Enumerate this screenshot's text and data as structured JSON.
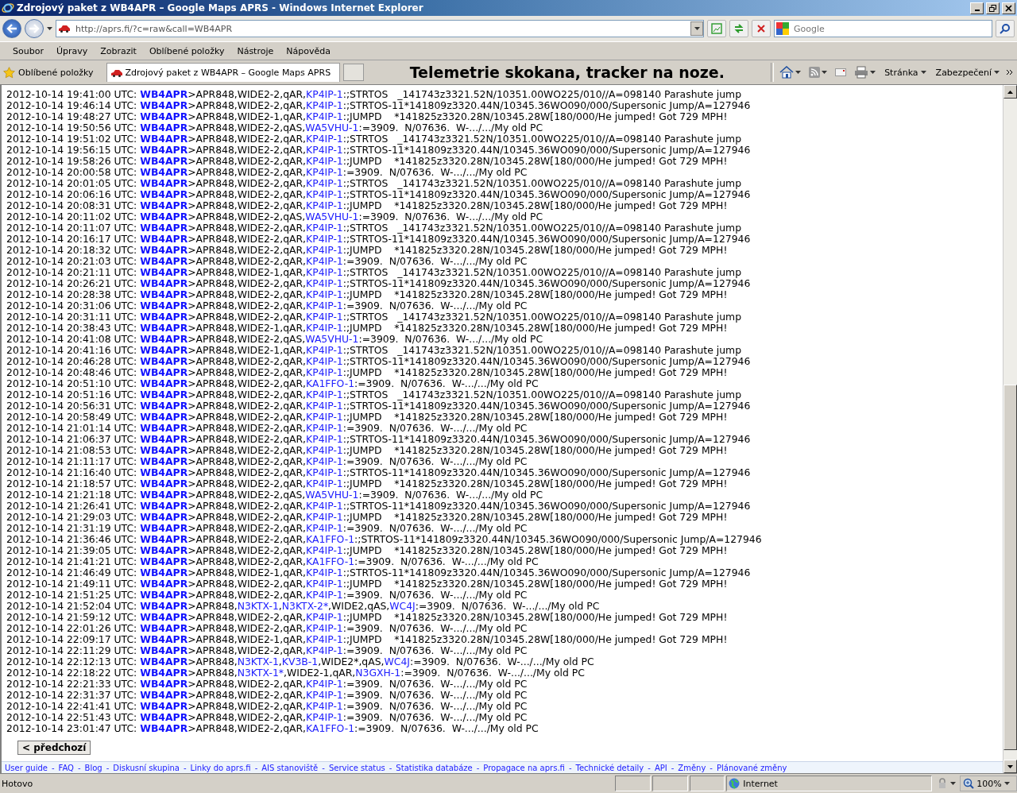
{
  "window": {
    "title": "Zdrojový paket z WB4APR – Google Maps APRS - Windows Internet Explorer"
  },
  "address_bar": {
    "value": "http://aprs.fi/?c=raw&call=WB4APR"
  },
  "search": {
    "placeholder": "Google"
  },
  "menu": [
    "Soubor",
    "Úpravy",
    "Zobrazit",
    "Oblíbené položky",
    "Nástroje",
    "Nápověda"
  ],
  "favorites": {
    "label": "Oblíbené položky"
  },
  "tabs": [
    {
      "label": "Zdrojový paket z WB4APR – Google Maps APRS",
      "selected": true
    }
  ],
  "page_heading": "Telemetrie skokana, tracker na noze.",
  "command_bar": [
    "Stránka",
    "Zabezpečení"
  ],
  "log": [
    {
      "time": "2012-10-14 19:41:00 UTC:",
      "source": "WB4APR",
      "parts": [
        {
          "text": ">APR848,WIDE2-2,qAR,",
          "link": false
        },
        {
          "text": "KP4IP-1",
          "link": true
        },
        {
          "text": ":;STRTOS   _141743z3321.52N/10351.00WO225/010//A=098140 Parashute jump",
          "link": false
        }
      ]
    },
    {
      "time": "2012-10-14 19:46:14 UTC:",
      "source": "WB4APR",
      "parts": [
        {
          "text": ">APR848,WIDE2-2,qAR,",
          "link": false
        },
        {
          "text": "KP4IP-1",
          "link": true
        },
        {
          "text": ":;STRTOS-11*141809z3320.44N/10345.36WO090/000/Supersonic Jump/A=127946",
          "link": false
        }
      ]
    },
    {
      "time": "2012-10-14 19:48:27 UTC:",
      "source": "WB4APR",
      "parts": [
        {
          "text": ">APR848,WIDE2-1,qAR,",
          "link": false
        },
        {
          "text": "KP4IP-1",
          "link": true
        },
        {
          "text": ":;JUMPD    *141825z3320.28N/10345.28W[180/000/He jumped! Got 729 MPH!",
          "link": false
        }
      ]
    },
    {
      "time": "2012-10-14 19:50:56 UTC:",
      "source": "WB4APR",
      "parts": [
        {
          "text": ">APR848,WIDE2-2,qAS,",
          "link": false
        },
        {
          "text": "WA5VHU-1",
          "link": true
        },
        {
          "text": ":=3909.  N/07636.  W-.../.../My old PC",
          "link": false
        }
      ]
    },
    {
      "time": "2012-10-14 19:51:02 UTC:",
      "source": "WB4APR",
      "parts": [
        {
          "text": ">APR848,WIDE2-2,qAR,",
          "link": false
        },
        {
          "text": "KP4IP-1",
          "link": true
        },
        {
          "text": ":;STRTOS   _141743z3321.52N/10351.00WO225/010//A=098140 Parashute jump",
          "link": false
        }
      ]
    },
    {
      "time": "2012-10-14 19:56:15 UTC:",
      "source": "WB4APR",
      "parts": [
        {
          "text": ">APR848,WIDE2-2,qAR,",
          "link": false
        },
        {
          "text": "KP4IP-1",
          "link": true
        },
        {
          "text": ":;STRTOS-11*141809z3320.44N/10345.36WO090/000/Supersonic Jump/A=127946",
          "link": false
        }
      ]
    },
    {
      "time": "2012-10-14 19:58:26 UTC:",
      "source": "WB4APR",
      "parts": [
        {
          "text": ">APR848,WIDE2-2,qAR,",
          "link": false
        },
        {
          "text": "KP4IP-1",
          "link": true
        },
        {
          "text": ":;JUMPD    *141825z3320.28N/10345.28W[180/000/He jumped! Got 729 MPH!",
          "link": false
        }
      ]
    },
    {
      "time": "2012-10-14 20:00:58 UTC:",
      "source": "WB4APR",
      "parts": [
        {
          "text": ">APR848,WIDE2-2,qAR,",
          "link": false
        },
        {
          "text": "KP4IP-1",
          "link": true
        },
        {
          "text": ":=3909.  N/07636.  W-.../.../My old PC",
          "link": false
        }
      ]
    },
    {
      "time": "2012-10-14 20:01:05 UTC:",
      "source": "WB4APR",
      "parts": [
        {
          "text": ">APR848,WIDE2-2,qAR,",
          "link": false
        },
        {
          "text": "KP4IP-1",
          "link": true
        },
        {
          "text": ":;STRTOS   _141743z3321.52N/10351.00WO225/010//A=098140 Parashute jump",
          "link": false
        }
      ]
    },
    {
      "time": "2012-10-14 20:06:16 UTC:",
      "source": "WB4APR",
      "parts": [
        {
          "text": ">APR848,WIDE2-2,qAR,",
          "link": false
        },
        {
          "text": "KP4IP-1",
          "link": true
        },
        {
          "text": ":;STRTOS-11*141809z3320.44N/10345.36WO090/000/Supersonic Jump/A=127946",
          "link": false
        }
      ]
    },
    {
      "time": "2012-10-14 20:08:31 UTC:",
      "source": "WB4APR",
      "parts": [
        {
          "text": ">APR848,WIDE2-2,qAR,",
          "link": false
        },
        {
          "text": "KP4IP-1",
          "link": true
        },
        {
          "text": ":;JUMPD    *141825z3320.28N/10345.28W[180/000/He jumped! Got 729 MPH!",
          "link": false
        }
      ]
    },
    {
      "time": "2012-10-14 20:11:02 UTC:",
      "source": "WB4APR",
      "parts": [
        {
          "text": ">APR848,WIDE2-2,qAS,",
          "link": false
        },
        {
          "text": "WA5VHU-1",
          "link": true
        },
        {
          "text": ":=3909.  N/07636.  W-.../.../My old PC",
          "link": false
        }
      ]
    },
    {
      "time": "2012-10-14 20:11:07 UTC:",
      "source": "WB4APR",
      "parts": [
        {
          "text": ">APR848,WIDE2-2,qAR,",
          "link": false
        },
        {
          "text": "KP4IP-1",
          "link": true
        },
        {
          "text": ":;STRTOS   _141743z3321.52N/10351.00WO225/010//A=098140 Parashute jump",
          "link": false
        }
      ]
    },
    {
      "time": "2012-10-14 20:16:17 UTC:",
      "source": "WB4APR",
      "parts": [
        {
          "text": ">APR848,WIDE2-2,qAR,",
          "link": false
        },
        {
          "text": "KP4IP-1",
          "link": true
        },
        {
          "text": ":;STRTOS-11*141809z3320.44N/10345.36WO090/000/Supersonic Jump/A=127946",
          "link": false
        }
      ]
    },
    {
      "time": "2012-10-14 20:18:32 UTC:",
      "source": "WB4APR",
      "parts": [
        {
          "text": ">APR848,WIDE2-2,qAR,",
          "link": false
        },
        {
          "text": "KP4IP-1",
          "link": true
        },
        {
          "text": ":;JUMPD    *141825z3320.28N/10345.28W[180/000/He jumped! Got 729 MPH!",
          "link": false
        }
      ]
    },
    {
      "time": "2012-10-14 20:21:03 UTC:",
      "source": "WB4APR",
      "parts": [
        {
          "text": ">APR848,WIDE2-2,qAR,",
          "link": false
        },
        {
          "text": "KP4IP-1",
          "link": true
        },
        {
          "text": ":=3909.  N/07636.  W-.../.../My old PC",
          "link": false
        }
      ]
    },
    {
      "time": "2012-10-14 20:21:11 UTC:",
      "source": "WB4APR",
      "parts": [
        {
          "text": ">APR848,WIDE2-1,qAR,",
          "link": false
        },
        {
          "text": "KP4IP-1",
          "link": true
        },
        {
          "text": ":;STRTOS   _141743z3321.52N/10351.00WO225/010//A=098140 Parashute jump",
          "link": false
        }
      ]
    },
    {
      "time": "2012-10-14 20:26:21 UTC:",
      "source": "WB4APR",
      "parts": [
        {
          "text": ">APR848,WIDE2-2,qAR,",
          "link": false
        },
        {
          "text": "KP4IP-1",
          "link": true
        },
        {
          "text": ":;STRTOS-11*141809z3320.44N/10345.36WO090/000/Supersonic Jump/A=127946",
          "link": false
        }
      ]
    },
    {
      "time": "2012-10-14 20:28:38 UTC:",
      "source": "WB4APR",
      "parts": [
        {
          "text": ">APR848,WIDE2-2,qAR,",
          "link": false
        },
        {
          "text": "KP4IP-1",
          "link": true
        },
        {
          "text": ":;JUMPD    *141825z3320.28N/10345.28W[180/000/He jumped! Got 729 MPH!",
          "link": false
        }
      ]
    },
    {
      "time": "2012-10-14 20:31:06 UTC:",
      "source": "WB4APR",
      "parts": [
        {
          "text": ">APR848,WIDE2-2,qAR,",
          "link": false
        },
        {
          "text": "KP4IP-1",
          "link": true
        },
        {
          "text": ":=3909.  N/07636.  W-.../.../My old PC",
          "link": false
        }
      ]
    },
    {
      "time": "2012-10-14 20:31:11 UTC:",
      "source": "WB4APR",
      "parts": [
        {
          "text": ">APR848,WIDE2-2,qAR,",
          "link": false
        },
        {
          "text": "KP4IP-1",
          "link": true
        },
        {
          "text": ":;STRTOS   _141743z3321.52N/10351.00WO225/010//A=098140 Parashute jump",
          "link": false
        }
      ]
    },
    {
      "time": "2012-10-14 20:38:43 UTC:",
      "source": "WB4APR",
      "parts": [
        {
          "text": ">APR848,WIDE2-1,qAR,",
          "link": false
        },
        {
          "text": "KP4IP-1",
          "link": true
        },
        {
          "text": ":;JUMPD    *141825z3320.28N/10345.28W[180/000/He jumped! Got 729 MPH!",
          "link": false
        }
      ]
    },
    {
      "time": "2012-10-14 20:41:08 UTC:",
      "source": "WB4APR",
      "parts": [
        {
          "text": ">APR848,WIDE2-2,qAS,",
          "link": false
        },
        {
          "text": "WA5VHU-1",
          "link": true
        },
        {
          "text": ":=3909.  N/07636.  W-.../.../My old PC",
          "link": false
        }
      ]
    },
    {
      "time": "2012-10-14 20:41:16 UTC:",
      "source": "WB4APR",
      "parts": [
        {
          "text": ">APR848,WIDE2-1,qAR,",
          "link": false
        },
        {
          "text": "KP4IP-1",
          "link": true
        },
        {
          "text": ":;STRTOS   _141743z3321.52N/10351.00WO225/010//A=098140 Parashute jump",
          "link": false
        }
      ]
    },
    {
      "time": "2012-10-14 20:46:28 UTC:",
      "source": "WB4APR",
      "parts": [
        {
          "text": ">APR848,WIDE2-2,qAR,",
          "link": false
        },
        {
          "text": "KP4IP-1",
          "link": true
        },
        {
          "text": ":;STRTOS-11*141809z3320.44N/10345.36WO090/000/Supersonic Jump/A=127946",
          "link": false
        }
      ]
    },
    {
      "time": "2012-10-14 20:48:46 UTC:",
      "source": "WB4APR",
      "parts": [
        {
          "text": ">APR848,WIDE2-2,qAR,",
          "link": false
        },
        {
          "text": "KP4IP-1",
          "link": true
        },
        {
          "text": ":;JUMPD    *141825z3320.28N/10345.28W[180/000/He jumped! Got 729 MPH!",
          "link": false
        }
      ]
    },
    {
      "time": "2012-10-14 20:51:10 UTC:",
      "source": "WB4APR",
      "parts": [
        {
          "text": ">APR848,WIDE2-2,qAR,",
          "link": false
        },
        {
          "text": "KA1FFO-1",
          "link": true
        },
        {
          "text": ":=3909.  N/07636.  W-.../.../My old PC",
          "link": false
        }
      ]
    },
    {
      "time": "2012-10-14 20:51:16 UTC:",
      "source": "WB4APR",
      "parts": [
        {
          "text": ">APR848,WIDE2-2,qAR,",
          "link": false
        },
        {
          "text": "KP4IP-1",
          "link": true
        },
        {
          "text": ":;STRTOS   _141743z3321.52N/10351.00WO225/010//A=098140 Parashute jump",
          "link": false
        }
      ]
    },
    {
      "time": "2012-10-14 20:56:31 UTC:",
      "source": "WB4APR",
      "parts": [
        {
          "text": ">APR848,WIDE2-2,qAR,",
          "link": false
        },
        {
          "text": "KP4IP-1",
          "link": true
        },
        {
          "text": ":;STRTOS-11*141809z3320.44N/10345.36WO090/000/Supersonic Jump/A=127946",
          "link": false
        }
      ]
    },
    {
      "time": "2012-10-14 20:58:49 UTC:",
      "source": "WB4APR",
      "parts": [
        {
          "text": ">APR848,WIDE2-2,qAR,",
          "link": false
        },
        {
          "text": "KP4IP-1",
          "link": true
        },
        {
          "text": ":;JUMPD    *141825z3320.28N/10345.28W[180/000/He jumped! Got 729 MPH!",
          "link": false
        }
      ]
    },
    {
      "time": "2012-10-14 21:01:14 UTC:",
      "source": "WB4APR",
      "parts": [
        {
          "text": ">APR848,WIDE2-2,qAR,",
          "link": false
        },
        {
          "text": "KP4IP-1",
          "link": true
        },
        {
          "text": ":=3909.  N/07636.  W-.../.../My old PC",
          "link": false
        }
      ]
    },
    {
      "time": "2012-10-14 21:06:37 UTC:",
      "source": "WB4APR",
      "parts": [
        {
          "text": ">APR848,WIDE2-2,qAR,",
          "link": false
        },
        {
          "text": "KP4IP-1",
          "link": true
        },
        {
          "text": ":;STRTOS-11*141809z3320.44N/10345.36WO090/000/Supersonic Jump/A=127946",
          "link": false
        }
      ]
    },
    {
      "time": "2012-10-14 21:08:53 UTC:",
      "source": "WB4APR",
      "parts": [
        {
          "text": ">APR848,WIDE2-2,qAR,",
          "link": false
        },
        {
          "text": "KP4IP-1",
          "link": true
        },
        {
          "text": ":;JUMPD    *141825z3320.28N/10345.28W[180/000/He jumped! Got 729 MPH!",
          "link": false
        }
      ]
    },
    {
      "time": "2012-10-14 21:11:17 UTC:",
      "source": "WB4APR",
      "parts": [
        {
          "text": ">APR848,WIDE2-2,qAR,",
          "link": false
        },
        {
          "text": "KP4IP-1",
          "link": true
        },
        {
          "text": ":=3909.  N/07636.  W-.../.../My old PC",
          "link": false
        }
      ]
    },
    {
      "time": "2012-10-14 21:16:40 UTC:",
      "source": "WB4APR",
      "parts": [
        {
          "text": ">APR848,WIDE2-2,qAR,",
          "link": false
        },
        {
          "text": "KP4IP-1",
          "link": true
        },
        {
          "text": ":;STRTOS-11*141809z3320.44N/10345.36WO090/000/Supersonic Jump/A=127946",
          "link": false
        }
      ]
    },
    {
      "time": "2012-10-14 21:18:57 UTC:",
      "source": "WB4APR",
      "parts": [
        {
          "text": ">APR848,WIDE2-2,qAR,",
          "link": false
        },
        {
          "text": "KP4IP-1",
          "link": true
        },
        {
          "text": ":;JUMPD    *141825z3320.28N/10345.28W[180/000/He jumped! Got 729 MPH!",
          "link": false
        }
      ]
    },
    {
      "time": "2012-10-14 21:21:18 UTC:",
      "source": "WB4APR",
      "parts": [
        {
          "text": ">APR848,WIDE2-2,qAS,",
          "link": false
        },
        {
          "text": "WA5VHU-1",
          "link": true
        },
        {
          "text": ":=3909.  N/07636.  W-.../.../My old PC",
          "link": false
        }
      ]
    },
    {
      "time": "2012-10-14 21:26:41 UTC:",
      "source": "WB4APR",
      "parts": [
        {
          "text": ">APR848,WIDE2-2,qAR,",
          "link": false
        },
        {
          "text": "KP4IP-1",
          "link": true
        },
        {
          "text": ":;STRTOS-11*141809z3320.44N/10345.36WO090/000/Supersonic Jump/A=127946",
          "link": false
        }
      ]
    },
    {
      "time": "2012-10-14 21:29:03 UTC:",
      "source": "WB4APR",
      "parts": [
        {
          "text": ">APR848,WIDE2-2,qAR,",
          "link": false
        },
        {
          "text": "KP4IP-1",
          "link": true
        },
        {
          "text": ":;JUMPD    *141825z3320.28N/10345.28W[180/000/He jumped! Got 729 MPH!",
          "link": false
        }
      ]
    },
    {
      "time": "2012-10-14 21:31:19 UTC:",
      "source": "WB4APR",
      "parts": [
        {
          "text": ">APR848,WIDE2-2,qAR,",
          "link": false
        },
        {
          "text": "KP4IP-1",
          "link": true
        },
        {
          "text": ":=3909.  N/07636.  W-.../.../My old PC",
          "link": false
        }
      ]
    },
    {
      "time": "2012-10-14 21:36:46 UTC:",
      "source": "WB4APR",
      "parts": [
        {
          "text": ">APR848,WIDE2-2,qAR,",
          "link": false
        },
        {
          "text": "KA1FFO-1",
          "link": true
        },
        {
          "text": ":;STRTOS-11*141809z3320.44N/10345.36WO090/000/Supersonic Jump/A=127946",
          "link": false
        }
      ]
    },
    {
      "time": "2012-10-14 21:39:05 UTC:",
      "source": "WB4APR",
      "parts": [
        {
          "text": ">APR848,WIDE2-2,qAR,",
          "link": false
        },
        {
          "text": "KP4IP-1",
          "link": true
        },
        {
          "text": ":;JUMPD    *141825z3320.28N/10345.28W[180/000/He jumped! Got 729 MPH!",
          "link": false
        }
      ]
    },
    {
      "time": "2012-10-14 21:41:21 UTC:",
      "source": "WB4APR",
      "parts": [
        {
          "text": ">APR848,WIDE2-2,qAR,",
          "link": false
        },
        {
          "text": "KA1FFO-1",
          "link": true
        },
        {
          "text": ":=3909.  N/07636.  W-.../.../My old PC",
          "link": false
        }
      ]
    },
    {
      "time": "2012-10-14 21:46:49 UTC:",
      "source": "WB4APR",
      "parts": [
        {
          "text": ">APR848,WIDE2-1,qAR,",
          "link": false
        },
        {
          "text": "KP4IP-1",
          "link": true
        },
        {
          "text": ":;STRTOS-11*141809z3320.44N/10345.36WO090/000/Supersonic Jump/A=127946",
          "link": false
        }
      ]
    },
    {
      "time": "2012-10-14 21:49:11 UTC:",
      "source": "WB4APR",
      "parts": [
        {
          "text": ">APR848,WIDE2-2,qAR,",
          "link": false
        },
        {
          "text": "KP4IP-1",
          "link": true
        },
        {
          "text": ":;JUMPD    *141825z3320.28N/10345.28W[180/000/He jumped! Got 729 MPH!",
          "link": false
        }
      ]
    },
    {
      "time": "2012-10-14 21:51:25 UTC:",
      "source": "WB4APR",
      "parts": [
        {
          "text": ">APR848,WIDE2-2,qAR,",
          "link": false
        },
        {
          "text": "KP4IP-1",
          "link": true
        },
        {
          "text": ":=3909.  N/07636.  W-.../.../My old PC",
          "link": false
        }
      ]
    },
    {
      "time": "2012-10-14 21:52:04 UTC:",
      "source": "WB4APR",
      "parts": [
        {
          "text": ">APR848,",
          "link": false
        },
        {
          "text": "N3KTX-1",
          "link": true
        },
        {
          "text": ",",
          "link": false
        },
        {
          "text": "N3KTX-2*",
          "link": true
        },
        {
          "text": ",WIDE2,qAS,",
          "link": false
        },
        {
          "text": "WC4J",
          "link": true
        },
        {
          "text": ":=3909.  N/07636.  W-.../.../My old PC",
          "link": false
        }
      ]
    },
    {
      "time": "2012-10-14 21:59:12 UTC:",
      "source": "WB4APR",
      "parts": [
        {
          "text": ">APR848,WIDE2-2,qAR,",
          "link": false
        },
        {
          "text": "KP4IP-1",
          "link": true
        },
        {
          "text": ":;JUMPD    *141825z3320.28N/10345.28W[180/000/He jumped! Got 729 MPH!",
          "link": false
        }
      ]
    },
    {
      "time": "2012-10-14 22:01:26 UTC:",
      "source": "WB4APR",
      "parts": [
        {
          "text": ">APR848,WIDE2-2,qAR,",
          "link": false
        },
        {
          "text": "KP4IP-1",
          "link": true
        },
        {
          "text": ":=3909.  N/07636.  W-.../.../My old PC",
          "link": false
        }
      ]
    },
    {
      "time": "2012-10-14 22:09:17 UTC:",
      "source": "WB4APR",
      "parts": [
        {
          "text": ">APR848,WIDE2-1,qAR,",
          "link": false
        },
        {
          "text": "KP4IP-1",
          "link": true
        },
        {
          "text": ":;JUMPD    *141825z3320.28N/10345.28W[180/000/He jumped! Got 729 MPH!",
          "link": false
        }
      ]
    },
    {
      "time": "2012-10-14 22:11:29 UTC:",
      "source": "WB4APR",
      "parts": [
        {
          "text": ">APR848,WIDE2-2,qAR,",
          "link": false
        },
        {
          "text": "KP4IP-1",
          "link": true
        },
        {
          "text": ":=3909.  N/07636.  W-.../.../My old PC",
          "link": false
        }
      ]
    },
    {
      "time": "2012-10-14 22:12:13 UTC:",
      "source": "WB4APR",
      "parts": [
        {
          "text": ">APR848,",
          "link": false
        },
        {
          "text": "N3KTX-1",
          "link": true
        },
        {
          "text": ",",
          "link": false
        },
        {
          "text": "KV3B-1",
          "link": true
        },
        {
          "text": ",WIDE2*,qAS,",
          "link": false
        },
        {
          "text": "WC4J",
          "link": true
        },
        {
          "text": ":=3909.  N/07636.  W-.../.../My old PC",
          "link": false
        }
      ]
    },
    {
      "time": "2012-10-14 22:18:22 UTC:",
      "source": "WB4APR",
      "parts": [
        {
          "text": ">APR848,",
          "link": false
        },
        {
          "text": "N3KTX-1*",
          "link": true
        },
        {
          "text": ",WIDE2-1,qAR,",
          "link": false
        },
        {
          "text": "N3GXH-1",
          "link": true
        },
        {
          "text": ":=3909.  N/07636.  W-.../.../My old PC",
          "link": false
        }
      ]
    },
    {
      "time": "2012-10-14 22:21:33 UTC:",
      "source": "WB4APR",
      "parts": [
        {
          "text": ">APR848,WIDE2-2,qAR,",
          "link": false
        },
        {
          "text": "KP4IP-1",
          "link": true
        },
        {
          "text": ":=3909.  N/07636.  W-.../.../My old PC",
          "link": false
        }
      ]
    },
    {
      "time": "2012-10-14 22:31:37 UTC:",
      "source": "WB4APR",
      "parts": [
        {
          "text": ">APR848,WIDE2-2,qAR,",
          "link": false
        },
        {
          "text": "KP4IP-1",
          "link": true
        },
        {
          "text": ":=3909.  N/07636.  W-.../.../My old PC",
          "link": false
        }
      ]
    },
    {
      "time": "2012-10-14 22:41:41 UTC:",
      "source": "WB4APR",
      "parts": [
        {
          "text": ">APR848,WIDE2-2,qAR,",
          "link": false
        },
        {
          "text": "KP4IP-1",
          "link": true
        },
        {
          "text": ":=3909.  N/07636.  W-.../.../My old PC",
          "link": false
        }
      ]
    },
    {
      "time": "2012-10-14 22:51:43 UTC:",
      "source": "WB4APR",
      "parts": [
        {
          "text": ">APR848,WIDE2-2,qAR,",
          "link": false
        },
        {
          "text": "KP4IP-1",
          "link": true
        },
        {
          "text": ":=3909.  N/07636.  W-.../.../My old PC",
          "link": false
        }
      ]
    },
    {
      "time": "2012-10-14 23:01:47 UTC:",
      "source": "WB4APR",
      "parts": [
        {
          "text": ">APR848,WIDE2-2,qAR,",
          "link": false
        },
        {
          "text": "KA1FFO-1",
          "link": true
        },
        {
          "text": ":=3909.  N/07636.  W-.../.../My old PC",
          "link": false
        }
      ]
    }
  ],
  "prev_button": "< předchozí",
  "footer_links": [
    "User guide",
    "FAQ",
    "Blog",
    "Diskusní skupina",
    "Linky do aprs.fi",
    "AIS stanoviště",
    "Service status",
    "Statistika databáze",
    "Propagace na aprs.fi",
    "Technické detaily",
    "API",
    "Změny",
    "Plánované změny"
  ],
  "footer_separator": "-",
  "status_bar": {
    "text": "Hotovo",
    "zone": "Internet",
    "zoom": "100%"
  }
}
